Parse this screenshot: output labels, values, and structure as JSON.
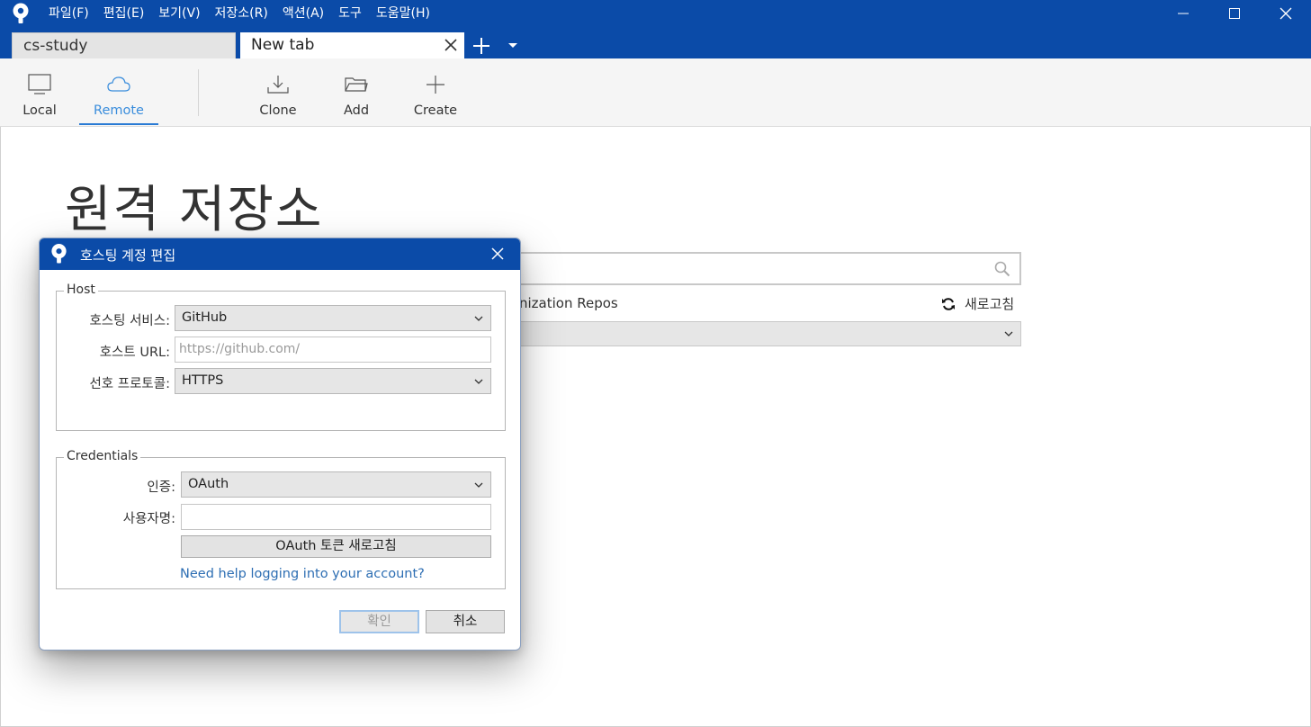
{
  "menubar": {
    "items": [
      "파일(F)",
      "편집(E)",
      "보기(V)",
      "저장소(R)",
      "액션(A)",
      "도구",
      "도움말(H)"
    ]
  },
  "tabs": [
    {
      "label": "cs-study"
    },
    {
      "label": "New tab"
    }
  ],
  "toolbar": {
    "local": "Local",
    "remote": "Remote",
    "clone": "Clone",
    "add": "Add",
    "create": "Create"
  },
  "main": {
    "title": "원격 저장소",
    "repo_type_text": "nization Repos",
    "refresh_label": "새로고침"
  },
  "dialog": {
    "title": "호스팅 계정 편집",
    "host": {
      "legend": "Host",
      "service_label": "호스팅 서비스:",
      "service_value": "GitHub",
      "url_label": "호스트 URL:",
      "url_placeholder": "https://github.com/",
      "protocol_label": "선호 프로토콜:",
      "protocol_value": "HTTPS"
    },
    "credentials": {
      "legend": "Credentials",
      "auth_label": "인증:",
      "auth_value": "OAuth",
      "username_label": "사용자명:",
      "username_value": "",
      "refresh_token_button": "OAuth 토큰 새로고침",
      "help_link": "Need help logging into your account?"
    },
    "ok_button": "확인",
    "cancel_button": "취소"
  },
  "colors": {
    "titlebar": "#0b4ba8",
    "accent": "#2a7bd4",
    "link": "#2d6eb3"
  }
}
